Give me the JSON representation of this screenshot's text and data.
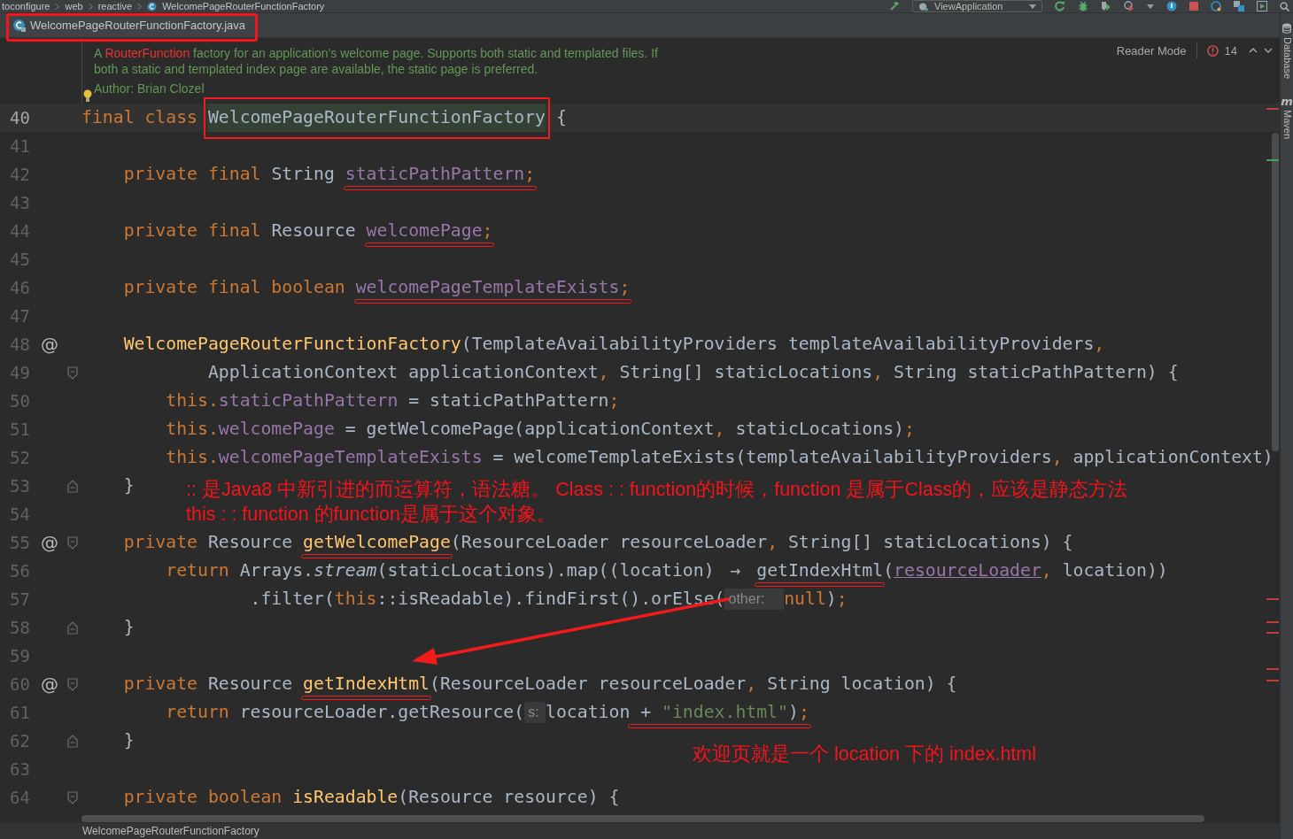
{
  "toolbar": {
    "breadcrumbs": [
      "toconfigure",
      "web",
      "reactive",
      "WelcomePageRouterFunctionFactory"
    ],
    "run_configuration": "ViewApplication"
  },
  "tabs": [
    {
      "label": "WelcomePageRouterFunctionFactory.java",
      "selected": true,
      "boxed": true
    }
  ],
  "inspection": {
    "reader_mode": "Reader Mode",
    "problem_count": "14"
  },
  "doc": {
    "before": "A ",
    "link": "RouterFunction",
    "after": " factory for an application's welcome page. Supports both static and templated files. If both a static and templated index page are available, the static page is preferred.",
    "author": "Author: Brian Clozel"
  },
  "code": {
    "lines": [
      {
        "number": "40",
        "current": true,
        "segments": [
          {
            "kind": "plain",
            "tokens": [
              {
                "kind": "kw",
                "text": "final class "
              }
            ]
          },
          {
            "kind": "boxed",
            "tokens": [
              {
                "kind": "highlight",
                "text": "WelcomePageRouterFunctionFactory"
              }
            ]
          },
          {
            "kind": "plain",
            "tokens": [
              {
                "kind": "plain",
                "text": " {"
              }
            ]
          }
        ]
      },
      {
        "number": "41",
        "current": false
      },
      {
        "number": "42",
        "current": false,
        "segments": [
          {
            "kind": "plain",
            "tokens": [
              {
                "kind": "kw",
                "text": "    private final "
              },
              {
                "kind": "plain",
                "text": "String "
              }
            ]
          },
          {
            "kind": "underlined",
            "tokens": [
              {
                "kind": "field",
                "text": "staticPathPattern"
              },
              {
                "kind": "punct",
                "text": ";"
              }
            ]
          }
        ]
      },
      {
        "number": "43",
        "current": false
      },
      {
        "number": "44",
        "current": false,
        "segments": [
          {
            "kind": "plain",
            "tokens": [
              {
                "kind": "kw",
                "text": "    private final "
              },
              {
                "kind": "plain",
                "text": "Resource "
              }
            ]
          },
          {
            "kind": "underlined",
            "tokens": [
              {
                "kind": "field",
                "text": "welcomePage"
              },
              {
                "kind": "punct",
                "text": ";"
              }
            ]
          }
        ]
      },
      {
        "number": "45",
        "current": false
      },
      {
        "number": "46",
        "current": false,
        "segments": [
          {
            "kind": "plain",
            "tokens": [
              {
                "kind": "kw",
                "text": "    private final boolean "
              }
            ]
          },
          {
            "kind": "underlined",
            "tokens": [
              {
                "kind": "field",
                "text": "welcomePageTemplateExists"
              },
              {
                "kind": "punct",
                "text": ";"
              }
            ]
          }
        ]
      },
      {
        "number": "47",
        "current": false
      },
      {
        "number": "48",
        "current": false,
        "marker": "@",
        "segments": [
          {
            "kind": "plain",
            "tokens": [
              {
                "kind": "method",
                "text": "    WelcomePageRouterFunctionFactory"
              },
              {
                "kind": "plain",
                "text": "(TemplateAvailabilityProviders templateAvailabilityProviders"
              },
              {
                "kind": "punct",
                "text": ","
              }
            ]
          }
        ]
      },
      {
        "number": "49",
        "current": false,
        "fold": {
          "kind": "start"
        },
        "segments": [
          {
            "kind": "plain",
            "tokens": [
              {
                "kind": "plain",
                "text": "            ApplicationContext applicationContext"
              },
              {
                "kind": "punct",
                "text": ", "
              },
              {
                "kind": "plain",
                "text": "String[] staticLocations"
              },
              {
                "kind": "punct",
                "text": ", "
              },
              {
                "kind": "plain",
                "text": "String staticPathPattern) {"
              }
            ]
          }
        ]
      },
      {
        "number": "50",
        "current": false,
        "segments": [
          {
            "kind": "plain",
            "tokens": [
              {
                "kind": "kw",
                "text": "        this."
              },
              {
                "kind": "field",
                "text": "staticPathPattern"
              },
              {
                "kind": "plain",
                "text": " = staticPathPattern"
              },
              {
                "kind": "punct",
                "text": ";"
              }
            ]
          }
        ]
      },
      {
        "number": "51",
        "current": false,
        "segments": [
          {
            "kind": "plain",
            "tokens": [
              {
                "kind": "kw",
                "text": "        this."
              },
              {
                "kind": "field",
                "text": "welcomePage"
              },
              {
                "kind": "plain",
                "text": " = getWelcomePage(applicationContext"
              },
              {
                "kind": "punct",
                "text": ", "
              },
              {
                "kind": "plain",
                "text": "staticLocations)"
              },
              {
                "kind": "punct",
                "text": ";"
              }
            ]
          }
        ]
      },
      {
        "number": "52",
        "current": false,
        "segments": [
          {
            "kind": "plain",
            "tokens": [
              {
                "kind": "kw",
                "text": "        this."
              },
              {
                "kind": "field",
                "text": "welcomePageTemplateExists"
              },
              {
                "kind": "plain",
                "text": " = welcomeTemplateExists(templateAvailabilityProviders"
              },
              {
                "kind": "punct",
                "text": ", "
              },
              {
                "kind": "plain",
                "text": "applicationContext)"
              }
            ]
          }
        ]
      },
      {
        "number": "53",
        "current": false,
        "fold": {
          "kind": "end"
        },
        "segments": [
          {
            "kind": "plain",
            "tokens": [
              {
                "kind": "plain",
                "text": "    }"
              }
            ]
          }
        ]
      },
      {
        "number": "54",
        "current": false
      },
      {
        "number": "55",
        "current": false,
        "marker": "@",
        "fold": {
          "kind": "start"
        },
        "segments": [
          {
            "kind": "plain",
            "tokens": [
              {
                "kind": "kw",
                "text": "    private "
              },
              {
                "kind": "plain",
                "text": "Resource "
              }
            ]
          },
          {
            "kind": "underlined",
            "tokens": [
              {
                "kind": "method",
                "text": "getWelcomePage"
              }
            ]
          },
          {
            "kind": "plain",
            "tokens": [
              {
                "kind": "plain",
                "text": "(ResourceLoader resourceLoader"
              },
              {
                "kind": "punct",
                "text": ", "
              },
              {
                "kind": "plain",
                "text": "String[] staticLocations) {"
              }
            ]
          }
        ]
      },
      {
        "number": "56",
        "current": false,
        "segments": [
          {
            "kind": "plain",
            "tokens": [
              {
                "kind": "kw",
                "text": "        return "
              },
              {
                "kind": "plain",
                "text": "Arrays."
              },
              {
                "kind": "italic",
                "text": "stream"
              },
              {
                "kind": "plain",
                "text": "(staticLocations).map((location) "
              },
              {
                "kind": "arrow",
                "text": "→ "
              }
            ]
          },
          {
            "kind": "underlined",
            "tokens": [
              {
                "kind": "plain",
                "text": "getIndexHtml"
              }
            ]
          },
          {
            "kind": "plain",
            "tokens": [
              {
                "kind": "plain",
                "text": "("
              },
              {
                "kind": "param",
                "text": "resourceLoader"
              },
              {
                "kind": "punct",
                "text": ", "
              },
              {
                "kind": "plain",
                "text": "location))"
              }
            ]
          }
        ]
      },
      {
        "number": "57",
        "current": false,
        "segments": [
          {
            "kind": "plain",
            "tokens": [
              {
                "kind": "plain",
                "text": "                .filter("
              },
              {
                "kind": "kw",
                "text": "this"
              },
              {
                "kind": "plain",
                "text": "::isReadable).findFirst().orElse("
              },
              {
                "kind": "hint",
                "text": "other:"
              },
              {
                "kind": "kw",
                "text": "null"
              },
              {
                "kind": "plain",
                "text": ")"
              },
              {
                "kind": "punct",
                "text": ";"
              }
            ]
          }
        ]
      },
      {
        "number": "58",
        "current": false,
        "fold": {
          "kind": "end"
        },
        "segments": [
          {
            "kind": "plain",
            "tokens": [
              {
                "kind": "plain",
                "text": "    }"
              }
            ]
          }
        ]
      },
      {
        "number": "59",
        "current": false
      },
      {
        "number": "60",
        "current": false,
        "marker": "@",
        "fold": {
          "kind": "start"
        },
        "segments": [
          {
            "kind": "plain",
            "tokens": [
              {
                "kind": "kw",
                "text": "    private "
              },
              {
                "kind": "plain",
                "text": "Resource "
              }
            ]
          },
          {
            "kind": "underlined",
            "tokens": [
              {
                "kind": "method",
                "text": "getIndexHtml"
              }
            ]
          },
          {
            "kind": "plain",
            "tokens": [
              {
                "kind": "plain",
                "text": "(ResourceLoader resourceLoader"
              },
              {
                "kind": "punct",
                "text": ", "
              },
              {
                "kind": "plain",
                "text": "String location) {"
              }
            ]
          }
        ]
      },
      {
        "number": "61",
        "current": false,
        "segments": [
          {
            "kind": "plain",
            "tokens": [
              {
                "kind": "kw",
                "text": "        return "
              },
              {
                "kind": "plain",
                "text": "resourceLoader.getResource("
              },
              {
                "kind": "hint",
                "text": "s:"
              },
              {
                "kind": "plain",
                "text": "location"
              }
            ]
          },
          {
            "kind": "underlined",
            "tokens": [
              {
                "kind": "plain",
                "text": " + "
              },
              {
                "kind": "string",
                "text": "\"index.html\""
              },
              {
                "kind": "plain",
                "text": ")"
              },
              {
                "kind": "punct",
                "text": ";"
              }
            ]
          }
        ]
      },
      {
        "number": "62",
        "current": false,
        "fold": {
          "kind": "end"
        },
        "segments": [
          {
            "kind": "plain",
            "tokens": [
              {
                "kind": "plain",
                "text": "    }"
              }
            ]
          }
        ]
      },
      {
        "number": "63",
        "current": false
      },
      {
        "number": "64",
        "current": false,
        "fold": {
          "kind": "start"
        },
        "segments": [
          {
            "kind": "plain",
            "tokens": [
              {
                "kind": "kw",
                "text": "    private boolean "
              },
              {
                "kind": "method",
                "text": "isReadable"
              },
              {
                "kind": "plain",
                "text": "(Resource resource) {"
              }
            ]
          }
        ]
      }
    ]
  },
  "notes": [
    ":: 是Java8 中新引进的而运算符，语法糖。 Class : : function的时候，function 是属于Class的，应该是静态方法",
    "this : :  function 的function是属于这个对象。",
    "欢迎页就是一个 location 下的 index.html"
  ],
  "error_stripe": [
    {
      "color": "#bc3f3c"
    },
    {
      "color": "#499c54"
    },
    {
      "color": "#bc3f3c"
    },
    {
      "color": "#bc3f3c"
    },
    {
      "color": "#bc3f3c"
    },
    {
      "color": "#bc3f3c"
    },
    {
      "color": "#bc3f3c"
    }
  ],
  "tool_stripe": [
    {
      "kind": "database",
      "label": "Database"
    },
    {
      "kind": "maven",
      "glyph": "m",
      "label": "Maven"
    }
  ],
  "status_bar": {
    "breadcrumb": "WelcomePageRouterFunctionFactory"
  }
}
